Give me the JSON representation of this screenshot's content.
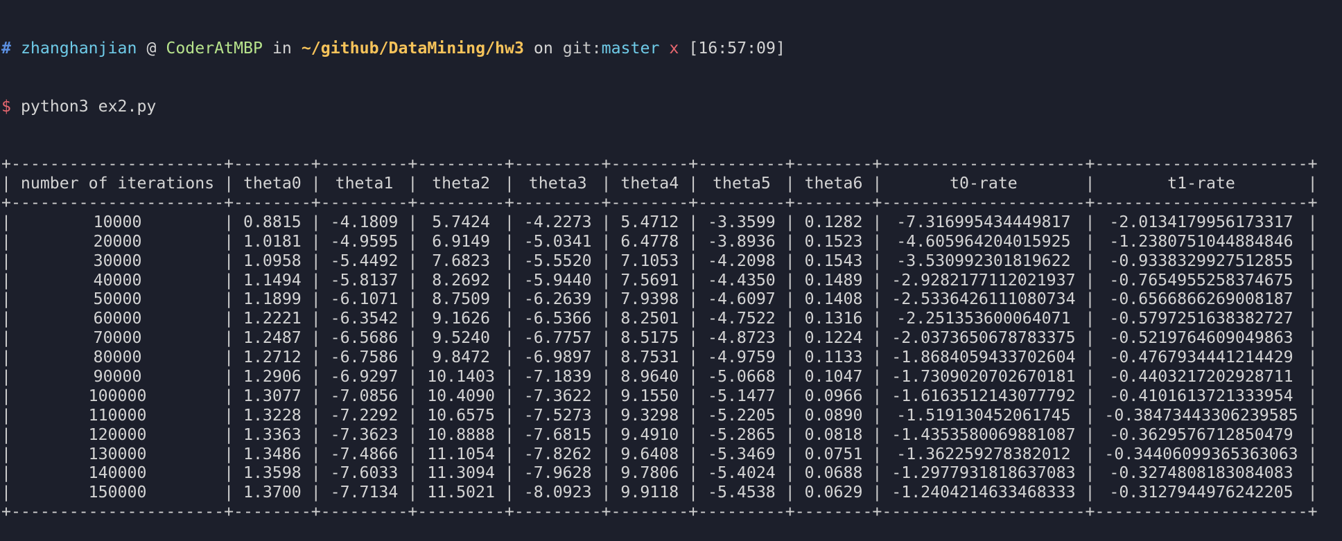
{
  "prompt": {
    "hash": "#",
    "user": "zhanghanjian",
    "at": "@",
    "host": "CoderAtMBP",
    "in": "in",
    "path": "~/github/DataMining/hw3",
    "on": "on",
    "git_label": "git:",
    "branch": "master",
    "dirty": "x",
    "time": "[16:57:09]",
    "dollar": "$",
    "command": "python3 ex2.py"
  },
  "colors": {
    "background": "#1c1f2b",
    "text": "#d4d4d4",
    "user": "#6fcbe8",
    "host": "#b7e38c",
    "path": "#f6c35a",
    "dirty": "#e8676f"
  },
  "table": {
    "headers": [
      "number of iterations",
      "theta0",
      "theta1",
      "theta2",
      "theta3",
      "theta4",
      "theta5",
      "theta6",
      "t0-rate",
      "t1-rate"
    ],
    "rows": [
      [
        "10000",
        "0.8815",
        "-4.1809",
        "5.7424",
        "-4.2273",
        "5.4712",
        "-3.3599",
        "0.1282",
        "-7.316995434449817",
        "-2.0134179956173317"
      ],
      [
        "20000",
        "1.0181",
        "-4.9595",
        "6.9149",
        "-5.0341",
        "6.4778",
        "-3.8936",
        "0.1523",
        "-4.605964204015925",
        "-1.2380751044884846"
      ],
      [
        "30000",
        "1.0958",
        "-5.4492",
        "7.6823",
        "-5.5520",
        "7.1053",
        "-4.2098",
        "0.1543",
        "-3.530992301819622",
        "-0.9338329927512855"
      ],
      [
        "40000",
        "1.1494",
        "-5.8137",
        "8.2692",
        "-5.9440",
        "7.5691",
        "-4.4350",
        "0.1489",
        "-2.9282177112021937",
        "-0.7654955258374675"
      ],
      [
        "50000",
        "1.1899",
        "-6.1071",
        "8.7509",
        "-6.2639",
        "7.9398",
        "-4.6097",
        "0.1408",
        "-2.5336426111080734",
        "-0.6566866269008187"
      ],
      [
        "60000",
        "1.2221",
        "-6.3542",
        "9.1626",
        "-6.5366",
        "8.2501",
        "-4.7522",
        "0.1316",
        "-2.251353600064071",
        "-0.5797251638382727"
      ],
      [
        "70000",
        "1.2487",
        "-6.5686",
        "9.5240",
        "-6.7757",
        "8.5175",
        "-4.8723",
        "0.1224",
        "-2.0373650678783375",
        "-0.5219764609049863"
      ],
      [
        "80000",
        "1.2712",
        "-6.7586",
        "9.8472",
        "-6.9897",
        "8.7531",
        "-4.9759",
        "0.1133",
        "-1.8684059433702604",
        "-0.4767934441214429"
      ],
      [
        "90000",
        "1.2906",
        "-6.9297",
        "10.1403",
        "-7.1839",
        "8.9640",
        "-5.0668",
        "0.1047",
        "-1.7309020702670181",
        "-0.4403217202928711"
      ],
      [
        "100000",
        "1.3077",
        "-7.0856",
        "10.4090",
        "-7.3622",
        "9.1550",
        "-5.1477",
        "0.0966",
        "-1.6163512143077792",
        "-0.4101613721333954"
      ],
      [
        "110000",
        "1.3228",
        "-7.2292",
        "10.6575",
        "-7.5273",
        "9.3298",
        "-5.2205",
        "0.0890",
        "-1.519130452061745",
        "-0.38473443306239585"
      ],
      [
        "120000",
        "1.3363",
        "-7.3623",
        "10.8888",
        "-7.6815",
        "9.4910",
        "-5.2865",
        "0.0818",
        "-1.4353580069881087",
        "-0.3629576712850479"
      ],
      [
        "130000",
        "1.3486",
        "-7.4866",
        "11.1054",
        "-7.8262",
        "9.6408",
        "-5.3469",
        "0.0751",
        "-1.362259278382012",
        "-0.34406099365363063"
      ],
      [
        "140000",
        "1.3598",
        "-7.6033",
        "11.3094",
        "-7.9628",
        "9.7806",
        "-5.4024",
        "0.0688",
        "-1.2977931818637083",
        "-0.3274808183084083"
      ],
      [
        "150000",
        "1.3700",
        "-7.7134",
        "11.5021",
        "-8.0923",
        "9.9118",
        "-5.4538",
        "0.0629",
        "-1.2404214633468333",
        "-0.3127944976242205"
      ]
    ]
  }
}
